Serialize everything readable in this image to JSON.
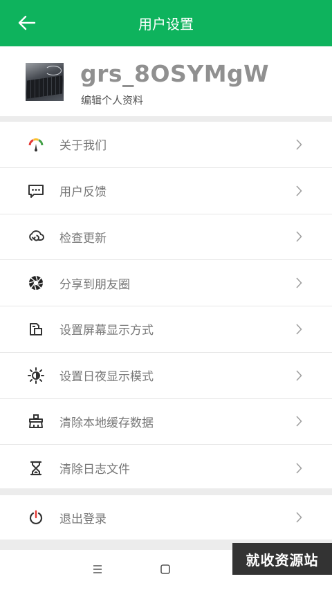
{
  "header": {
    "title": "用户设置",
    "back_icon": "arrow-left-icon"
  },
  "profile": {
    "username": "grs_8OSYMgW",
    "edit_label": "编辑个人资料",
    "avatar": "avatar-keyboard-photo"
  },
  "menu": {
    "items": [
      {
        "label": "关于我们",
        "icon": "gauge-icon"
      },
      {
        "label": "用户反馈",
        "icon": "chat-bubble-icon"
      },
      {
        "label": "检查更新",
        "icon": "cloud-sync-icon"
      },
      {
        "label": "分享到朋友圈",
        "icon": "aperture-icon"
      },
      {
        "label": "设置屏幕显示方式",
        "icon": "screen-rotate-icon"
      },
      {
        "label": "设置日夜显示模式",
        "icon": "sun-moon-icon"
      },
      {
        "label": "清除本地缓存数据",
        "icon": "clean-brush-icon"
      },
      {
        "label": "清除日志文件",
        "icon": "hourglass-icon"
      }
    ]
  },
  "logout": {
    "label": "退出登录",
    "icon": "power-icon"
  },
  "watermark": {
    "text": "就收资源站"
  },
  "colors": {
    "accent": "#0eb35d",
    "divider": "#ececec",
    "label": "#777777"
  }
}
